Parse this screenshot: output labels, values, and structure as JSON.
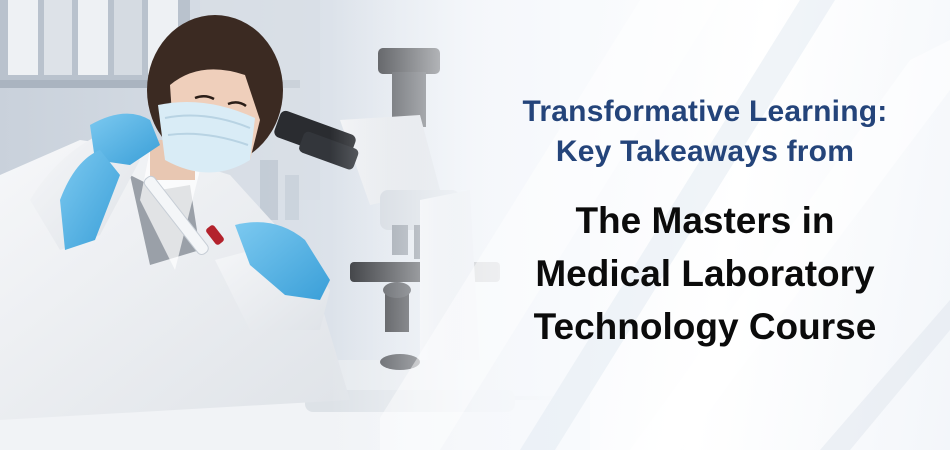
{
  "headline": {
    "subtitle_line1": "Transformative Learning:",
    "subtitle_line2": "Key Takeaways from",
    "title_line1": "The Masters in",
    "title_line2": "Medical Laboratory",
    "title_line3": "Technology Course"
  },
  "colors": {
    "subtitle": "#24447a",
    "title": "#0b0b0b",
    "glove": "#4fb3e8"
  }
}
